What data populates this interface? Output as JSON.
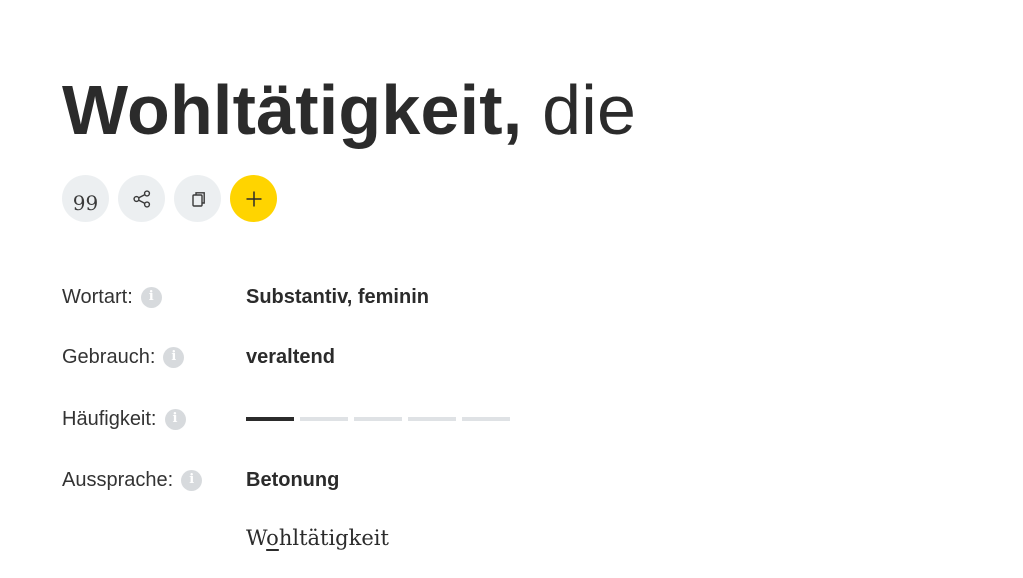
{
  "headword": {
    "lemma": "Wohltätigkeit,",
    "article": "die"
  },
  "actions": [
    {
      "name": "quote",
      "icon": "quote-icon"
    },
    {
      "name": "share",
      "icon": "share-icon"
    },
    {
      "name": "copy",
      "icon": "copy-icon"
    },
    {
      "name": "add",
      "icon": "plus-icon"
    }
  ],
  "colors": {
    "accent": "#ffd400",
    "button_bg": "#eceff1",
    "text": "#2b2b2b",
    "info_icon": "#d7dadd"
  },
  "rows": {
    "wortart": {
      "label": "Wortart:",
      "value": "Substantiv, feminin"
    },
    "gebrauch": {
      "label": "Gebrauch:",
      "value": "veraltend"
    },
    "haeufigkeit": {
      "label": "Häufigkeit:",
      "level": 1,
      "max": 5
    },
    "aussprache": {
      "label": "Aussprache:",
      "value": "Betonung"
    }
  },
  "pronunciation": {
    "before": "W",
    "stressed": "o",
    "after": "hltätigkeit"
  }
}
